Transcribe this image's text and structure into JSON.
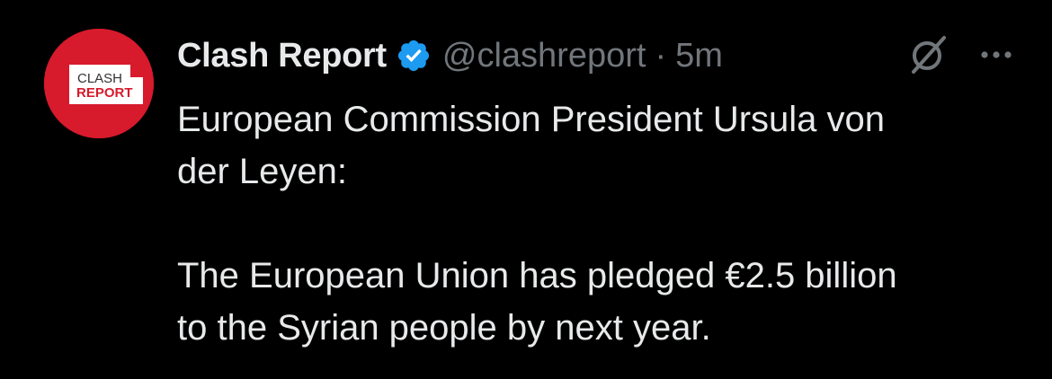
{
  "tweet": {
    "avatar_text_line1": "CLASH",
    "avatar_text_line2": "REPORT",
    "display_name": "Clash Report",
    "handle": "@clashreport",
    "separator": "·",
    "time": "5m",
    "text": "European Commission President Ursula von\nder Leyen:\n\nThe European Union has pledged €2.5 billion\nto the Syrian people by next year."
  },
  "colors": {
    "background": "#000000",
    "text": "#e7e9ea",
    "secondary": "#71767b",
    "verified_badge": "#1d9bf0",
    "avatar_red": "#d71a2c"
  },
  "icons": [
    "verified-badge-icon",
    "grok-icon",
    "more-options-icon"
  ]
}
